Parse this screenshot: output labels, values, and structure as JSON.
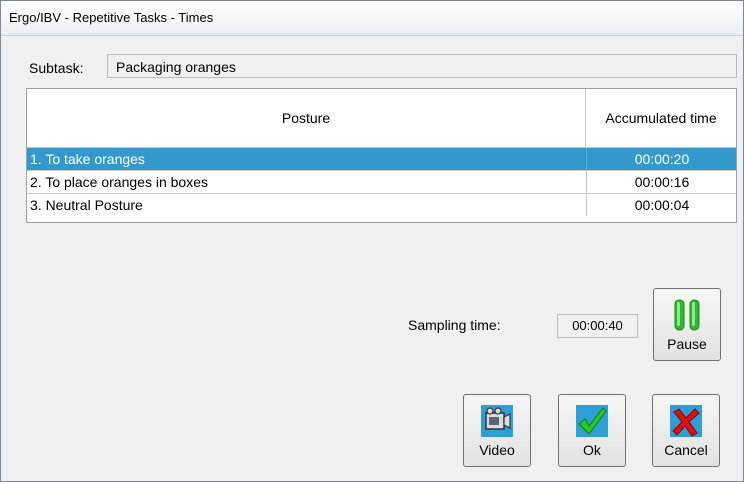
{
  "window": {
    "title": "Ergo/IBV - Repetitive Tasks - Times"
  },
  "subtask": {
    "label": "Subtask:",
    "value": "Packaging oranges"
  },
  "table": {
    "headers": [
      "Posture",
      "Accumulated time"
    ],
    "rows": [
      {
        "posture": "1. To take oranges",
        "time": "00:00:20",
        "selected": true
      },
      {
        "posture": "2. To place oranges in boxes",
        "time": "00:00:16",
        "selected": false
      },
      {
        "posture": "3. Neutral Posture",
        "time": "00:00:04",
        "selected": false
      }
    ]
  },
  "sampling": {
    "label": "Sampling time:",
    "value": "00:00:40"
  },
  "buttons": {
    "pause": {
      "label": "Pause",
      "icon": "pause-icon"
    },
    "video": {
      "label": "Video",
      "icon": "video-camera-icon"
    },
    "ok": {
      "label": "Ok",
      "icon": "checkmark-icon"
    },
    "cancel": {
      "label": "Cancel",
      "icon": "cross-icon"
    }
  },
  "colors": {
    "selection": "#3399cc",
    "pause_green": "#2db82d",
    "ok_green": "#22aa22",
    "cancel_red": "#dd1111",
    "icon_blue": "#2e9fd6"
  }
}
